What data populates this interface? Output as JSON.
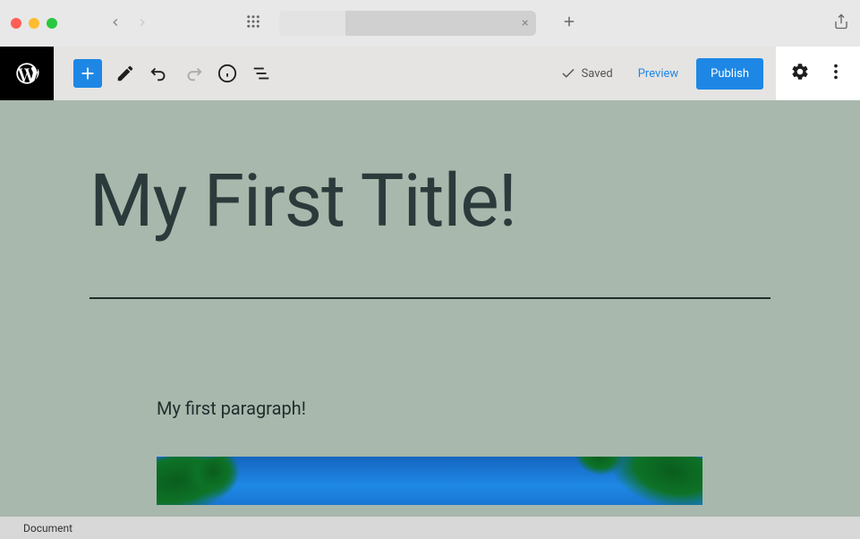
{
  "editor_toolbar": {
    "saved_label": "Saved",
    "preview_label": "Preview",
    "publish_label": "Publish"
  },
  "content": {
    "title": "My First Title!",
    "paragraph": "My first paragraph!"
  },
  "status_bar": {
    "label": "Document"
  },
  "icons": {
    "close": "×",
    "plus": "+"
  }
}
